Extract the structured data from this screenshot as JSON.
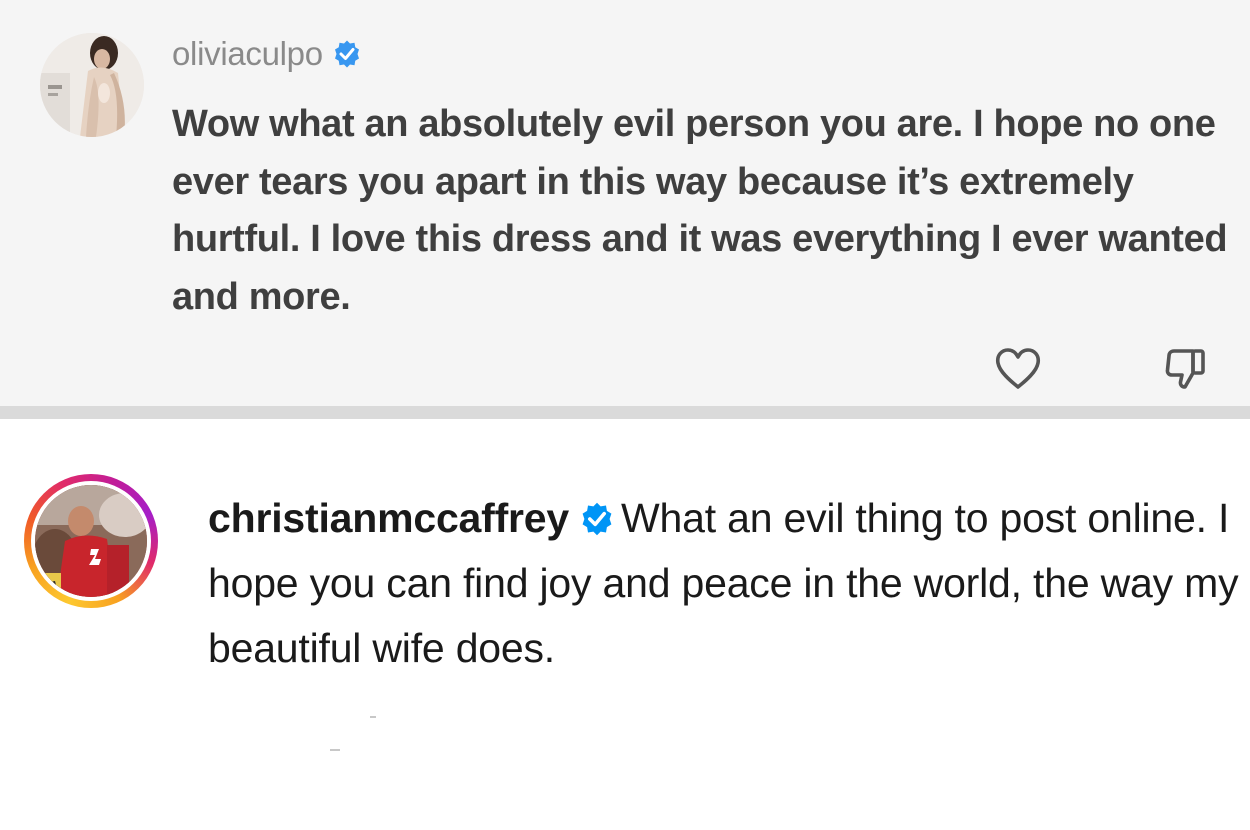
{
  "comment_top": {
    "username": "oliviaculpo",
    "verified_color": "#3897f0",
    "text": "Wow what an absolutely evil person you are. I hope no one ever tears you apart in this way because it’s extremely hurtful. I love this dress and it was everything I ever wanted and more.",
    "like_icon": "heart-outline-icon",
    "dislike_icon": "thumbs-down-outline-icon"
  },
  "comment_bottom": {
    "username": "christianmccaffrey",
    "verified_color": "#0095f6",
    "text": "What an evil thing to post online. I hope you can find joy and peace in the world, the way my beautiful wife does.",
    "story_ring_colors": [
      "#fdc830",
      "#f05a28",
      "#c21d97"
    ]
  }
}
